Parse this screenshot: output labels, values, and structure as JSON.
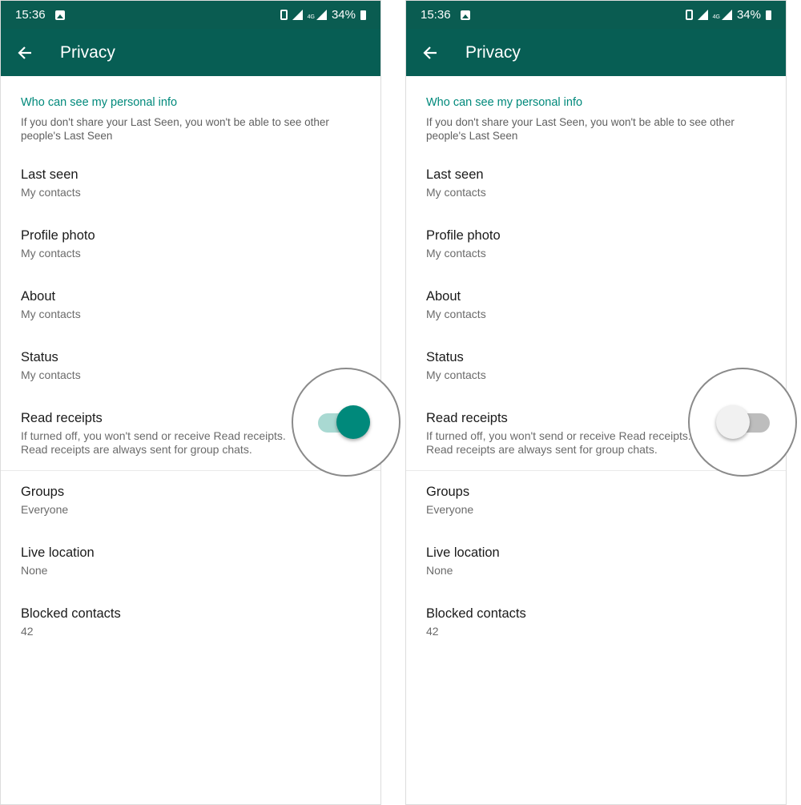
{
  "status_bar": {
    "time": "15:36",
    "network": "4G",
    "battery": "34%"
  },
  "app_bar": {
    "title": "Privacy"
  },
  "section": {
    "title": "Who can see my personal info",
    "description": "If you don't share your Last Seen, you won't be able to see other people's Last Seen"
  },
  "items": [
    {
      "title": "Last seen",
      "value": "My contacts"
    },
    {
      "title": "Profile photo",
      "value": "My contacts"
    },
    {
      "title": "About",
      "value": "My contacts"
    },
    {
      "title": "Status",
      "value": "My contacts"
    }
  ],
  "read_receipts": {
    "title": "Read receipts",
    "description": "If turned off, you won't send or receive Read receipts. Read receipts are always sent for group chats."
  },
  "items2": [
    {
      "title": "Groups",
      "value": "Everyone"
    },
    {
      "title": "Live location",
      "value": "None"
    },
    {
      "title": "Blocked contacts",
      "value": "42"
    }
  ],
  "screens": [
    {
      "read_receipts_on": true
    },
    {
      "read_receipts_on": false
    }
  ],
  "colors": {
    "status_bar": "#0a5c51",
    "app_bar": "#075e54",
    "accent": "#00897b",
    "toggle_track_on": "#a9d9d2",
    "toggle_off": "#bdbdbd"
  },
  "icons": [
    "back-arrow-icon",
    "gallery-icon",
    "vibrate-icon",
    "signal-icon",
    "battery-icon"
  ]
}
